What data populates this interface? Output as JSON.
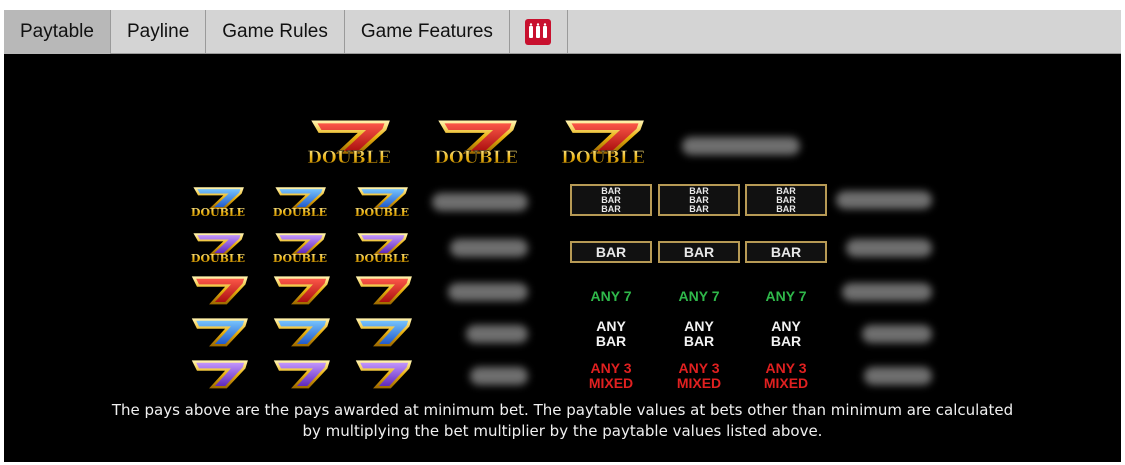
{
  "tabs": [
    {
      "label": "Paytable",
      "active": true
    },
    {
      "label": "Payline",
      "active": false
    },
    {
      "label": "Game Rules",
      "active": false
    },
    {
      "label": "Game Features",
      "active": false
    }
  ],
  "logo": {
    "icon": "dwg-logo-icon",
    "color": "#c8102e"
  },
  "paytable": {
    "double_seven_word": "DOUBLE",
    "bar_word": "BAR",
    "any_seven": "ANY 7",
    "any_bar_line1": "ANY",
    "any_bar_line2": "BAR",
    "any3_line1": "ANY 3",
    "any3_line2": "MIXED",
    "symbols": {
      "gold_double_seven": "gold-double-seven-icon",
      "blue_double_seven": "blue-double-seven-icon",
      "purple_double_seven": "purple-double-seven-icon",
      "red_seven": "red-seven-icon",
      "blue_seven": "blue-seven-icon",
      "purple_seven": "purple-seven-icon",
      "triple_bar": "triple-bar-icon",
      "single_bar": "single-bar-icon"
    }
  },
  "colors": {
    "background": "#000000",
    "tabbar": "#d4d4d4",
    "gold": "#e9b10f",
    "any7": "#2fb84a",
    "mixed": "#e02020"
  },
  "footer": {
    "line1": "The pays above are the pays awarded at minimum bet. The paytable values at bets other than minimum are calculated",
    "line2": "by multiplying the bet multiplier by the paytable values listed above."
  }
}
